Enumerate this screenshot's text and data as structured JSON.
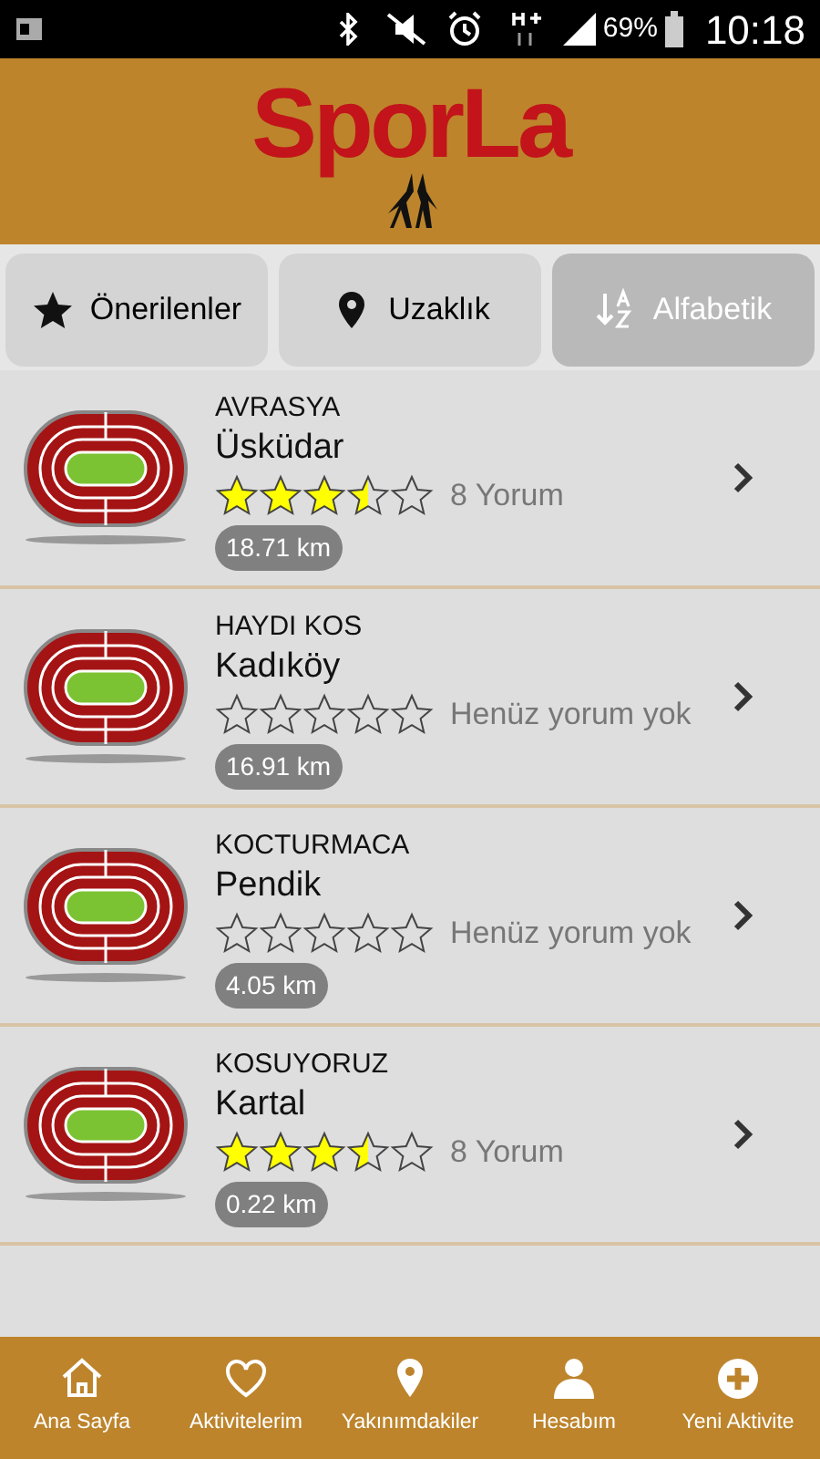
{
  "status_bar": {
    "battery": "69%",
    "time": "10:18"
  },
  "header": {
    "logo": "SporLa"
  },
  "tabs": [
    {
      "label": "Önerilenler",
      "selected": false
    },
    {
      "label": "Uzaklık",
      "selected": false
    },
    {
      "label": "Alfabetik",
      "selected": true
    }
  ],
  "places": [
    {
      "name": "AVRASYA",
      "district": "Üsküdar",
      "stars": 3.5,
      "reviews": "8 Yorum",
      "distance": "18.71 km"
    },
    {
      "name": "HAYDI KOS",
      "district": "Kadıköy",
      "stars": 0,
      "reviews": "Henüz yorum yok",
      "distance": "16.91 km"
    },
    {
      "name": "KOCTURMACA",
      "district": "Pendik",
      "stars": 0,
      "reviews": "Henüz yorum yok",
      "distance": "4.05 km"
    },
    {
      "name": "KOSUYORUZ",
      "district": "Kartal",
      "stars": 3.5,
      "reviews": "8 Yorum",
      "distance": "0.22 km"
    }
  ],
  "nav": [
    {
      "label": "Ana Sayfa"
    },
    {
      "label": "Aktivitelerim"
    },
    {
      "label": "Yakınımdakiler"
    },
    {
      "label": "Hesabım"
    },
    {
      "label": "Yeni Aktivite"
    }
  ]
}
